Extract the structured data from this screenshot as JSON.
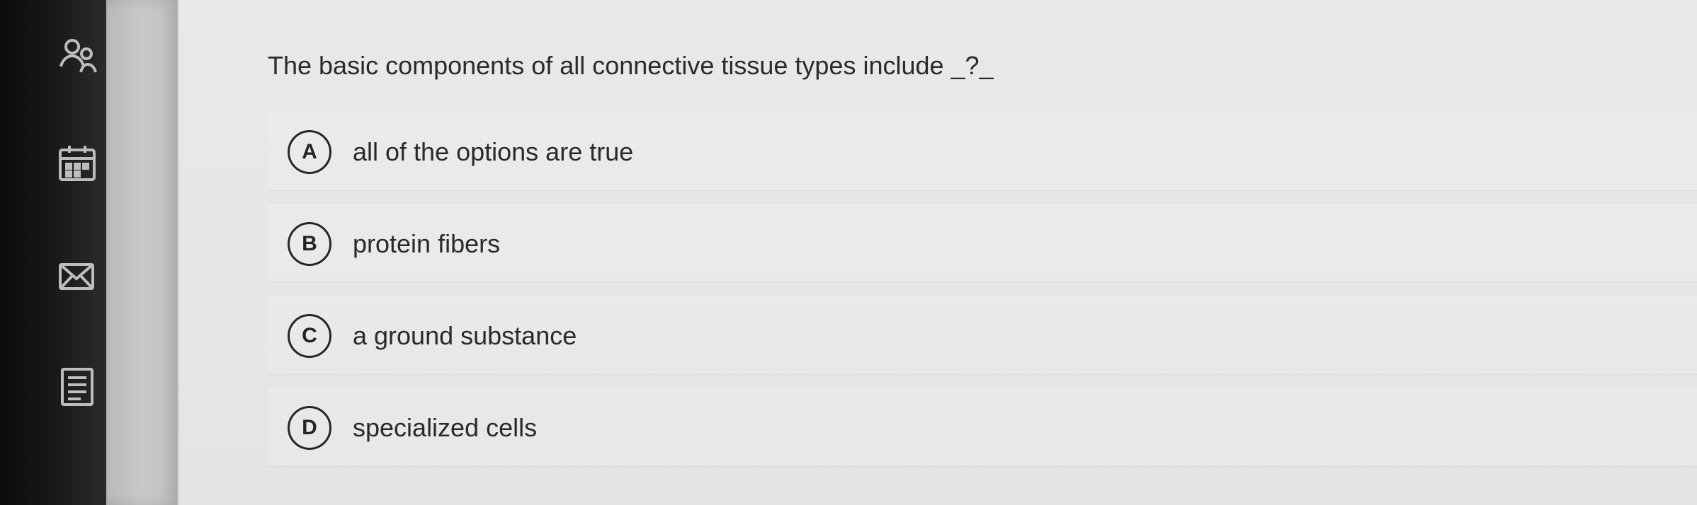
{
  "quiz": {
    "question": "The basic components of all connective tissue types include _?_",
    "options": [
      {
        "letter": "A",
        "text": "all of the options are true"
      },
      {
        "letter": "B",
        "text": "protein fibers"
      },
      {
        "letter": "C",
        "text": "a ground substance"
      },
      {
        "letter": "D",
        "text": "specialized cells"
      }
    ]
  },
  "sidebar": {
    "icons": [
      "people-icon",
      "calendar-icon",
      "mail-icon",
      "document-icon"
    ]
  },
  "colors": {
    "page_background": "#e7e7e5",
    "sidebar_background": "#121212",
    "text": "#2a2a2a",
    "letter_border": "#262626"
  }
}
